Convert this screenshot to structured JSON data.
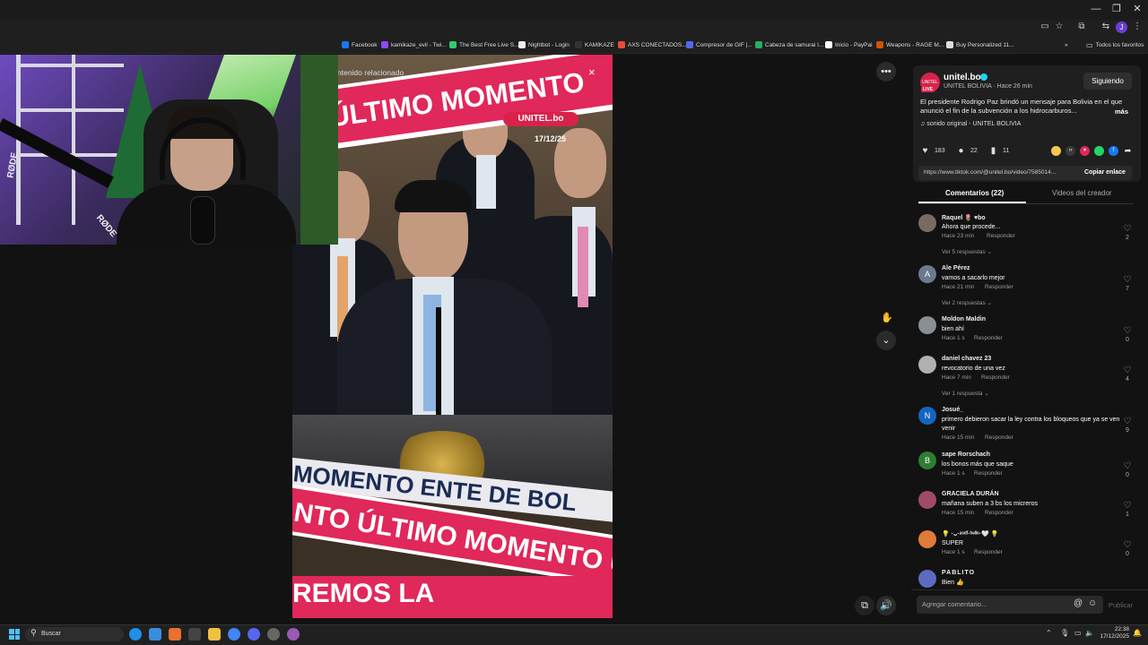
{
  "bookmarks": [
    {
      "label": "Facebook",
      "color": "#1877f2"
    },
    {
      "label": "kamikaze_evil - Twi...",
      "color": "#9146ff"
    },
    {
      "label": "The Best Free Live S...",
      "color": "#2ecc71"
    },
    {
      "label": "Nightbot - Login",
      "color": "#eeeeee"
    },
    {
      "label": "KAMIKAZE",
      "color": "#333333"
    },
    {
      "label": "AXS CONECTADOS...",
      "color": "#e74c3c"
    },
    {
      "label": "Compresor de GIF |...",
      "color": "#5865f2"
    },
    {
      "label": "Cabeza de samurai I...",
      "color": "#27ae60"
    },
    {
      "label": "Inicio - PayPal",
      "color": "#ffffff"
    },
    {
      "label": "Weapons - RAGE M...",
      "color": "#d35400"
    },
    {
      "label": "Buy Personalized 11...",
      "color": "#dddddd"
    }
  ],
  "bookmarks_all": "Todos los favoritos",
  "webcam": {
    "brand": "RØDE"
  },
  "video": {
    "related_label": "ntenido relacionado",
    "banner_text": "ÚLTIMO MOMENTO",
    "banner_text_lower": "NTO ÚLTIMO MOMENTO ÚL",
    "broadcaster_text": "MOMENTO  ENTE DE BOL",
    "bottom_text": "REMOS LA",
    "logo": "UNITEL.bo",
    "date": "17/12/25"
  },
  "creator": {
    "handle": "unitel.bo",
    "live_tag": "LIVE",
    "subtitle": "UNITEL BOLIVIA · Hace 26 min",
    "follow_label": "Siguiendo",
    "description": "El presidente Rodrigo Paz brindó un mensaje para Bolivia en el que anunció el fin de la subvención a los hidrocarburos...",
    "more_label": "más",
    "sound": "♫  sonido original - UNITEL BOLIVIA"
  },
  "stats": {
    "likes": "183",
    "comments": "22",
    "saves": "11"
  },
  "share": {
    "url": "https://www.tiktok.com/@unitel.bo/video/7585014...",
    "copy_label": "Copiar enlace"
  },
  "tabs": {
    "comments": "Comentarios (22)",
    "videos": "Videos del creador"
  },
  "comments": [
    {
      "name": "Raquel 🌷 ♥bo",
      "text": "Ahora que procede...",
      "time": "Hace 23 min",
      "likes": "2",
      "avatar": "",
      "avatar_color": "#7a6a66",
      "replies": "Ver 5 respuestas"
    },
    {
      "name": "Ale Pérez",
      "text": "vamos a sacarlo mejor",
      "time": "Hace 21 min",
      "likes": "7",
      "avatar": "A",
      "avatar_color": "#6b7a8f",
      "replies": "Ver 2 respuestas"
    },
    {
      "name": "Moldon Maldin",
      "text": "bien ahí",
      "time": "Hace 1 s",
      "likes": "0",
      "avatar": "",
      "avatar_color": "#8a8f93",
      "replies": ""
    },
    {
      "name": "daniel chavez 23",
      "text": "revocatorio de una vez",
      "time": "Hace 7 min",
      "likes": "4",
      "avatar": "",
      "avatar_color": "#b0b0b0",
      "replies": "Ver 1 respuesta"
    },
    {
      "name": "Josué_",
      "text": "primero debieron sacar la ley contra los bloqueos que ya se ven venir",
      "time": "Hace 15 min",
      "likes": "9",
      "avatar": "N",
      "avatar_color": "#1565c0",
      "replies": ""
    },
    {
      "name": "sape Rorschach",
      "text": "los bonos más que saque",
      "time": "Hace 1 s",
      "likes": "0",
      "avatar": "B",
      "avatar_color": "#2e7d32",
      "replies": ""
    },
    {
      "name": "GRACIELA DURÁN",
      "text": "mañana suben a 3 bs los micreros",
      "time": "Hace 15 min",
      "likes": "1",
      "avatar": "",
      "avatar_color": "#a04a6a",
      "replies": ""
    },
    {
      "name": "💡 ·ᴗ·ᵃˢᵈᶠ·ʰᵉˡˡᵒ·🤍 💡",
      "text": "SUPER",
      "time": "Hace 1 s",
      "likes": "0",
      "avatar": "",
      "avatar_color": "#e07a3a",
      "replies": ""
    },
    {
      "name": "PABLITO",
      "text": "Bien 👍",
      "time": "",
      "likes": "",
      "avatar": "",
      "avatar_color": "#5c6bc0",
      "replies": ""
    }
  ],
  "reply_label": "Responder",
  "comment_input": {
    "placeholder": "Agregar comentario...",
    "publish": "Publicar"
  },
  "taskbar": {
    "search": "Buscar",
    "time": "22:38",
    "date": "17/12/2025"
  }
}
